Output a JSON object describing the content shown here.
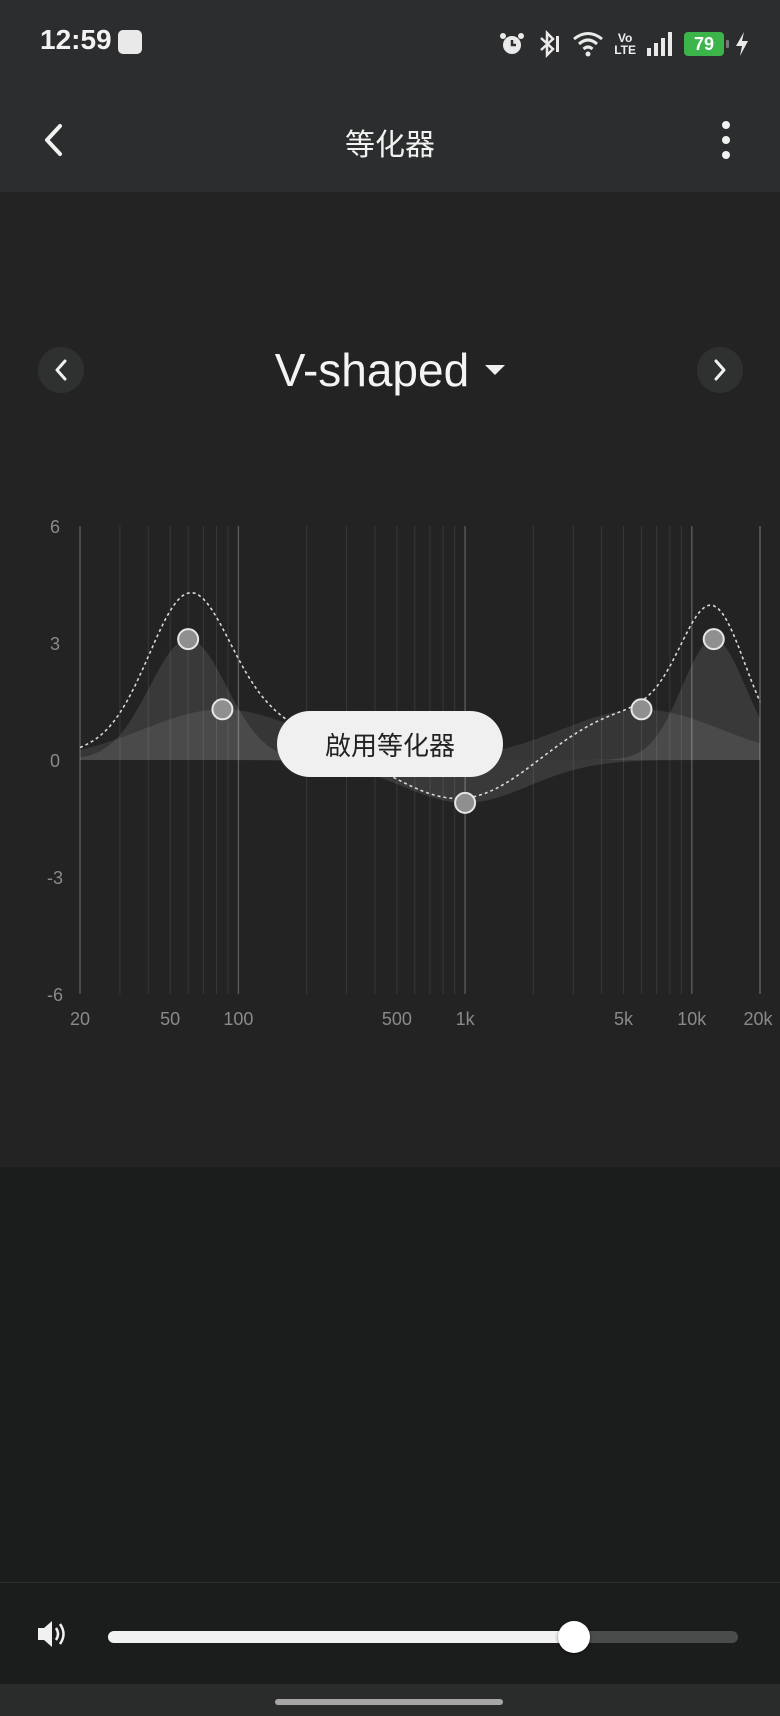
{
  "status_bar": {
    "time": "12:59",
    "app_icon": "audio-technica-icon",
    "icons": [
      "alarm-icon",
      "bluetooth-icon",
      "wifi-icon",
      "volte-icon",
      "signal-icon"
    ],
    "volte_top": "Vo",
    "volte_bottom": "LTE",
    "battery_level": "79",
    "charging_icon": "lightning-icon"
  },
  "header": {
    "title": "等化器",
    "back_icon": "chevron-left-icon",
    "more_icon": "more-vertical-icon"
  },
  "preset": {
    "name": "V-shaped",
    "prev_icon": "chevron-left-icon",
    "next_icon": "chevron-right-icon",
    "dropdown_icon": "caret-down-icon"
  },
  "eq_chart": {
    "type": "line",
    "y_ticks": [
      "6",
      "3",
      "0",
      "-3",
      "-6"
    ],
    "y_range": [
      -6,
      6
    ],
    "x_ticks": [
      "20",
      "50",
      "100",
      "500",
      "1k",
      "5k",
      "10k",
      "20k"
    ],
    "x_tick_hz": [
      20,
      50,
      100,
      500,
      1000,
      5000,
      10000,
      20000
    ],
    "x_range_hz": [
      20,
      20000
    ],
    "x_scale": "log",
    "bands": [
      {
        "freq_hz": 60,
        "gain_db": 3.1
      },
      {
        "freq_hz": 85,
        "gain_db": 1.3
      },
      {
        "freq_hz": 1000,
        "gain_db": -1.1
      },
      {
        "freq_hz": 6000,
        "gain_db": 1.3
      },
      {
        "freq_hz": 12500,
        "gain_db": 3.1
      }
    ]
  },
  "enable_button": {
    "label": "啟用等化器"
  },
  "volume": {
    "icon": "speaker-icon",
    "level_percent": 74
  }
}
